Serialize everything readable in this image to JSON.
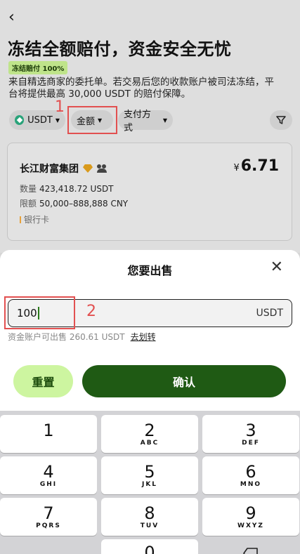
{
  "header": {
    "back_icon": "chevron-left-icon",
    "title": "冻结全额赔付，资金安全无忧",
    "badge": "冻结赔付 100%",
    "intro_line1": "来自精选商家的委托单。若交易后您的收款账户被司法冻结，平",
    "intro_line2": "台将提供最高 30,000 USDT 的赔付保障。"
  },
  "filters": {
    "currency": "USDT",
    "amount": "金额",
    "payment": "支付方式",
    "filter_icon": "funnel-icon"
  },
  "annotations": {
    "step1": "1",
    "step2": "2"
  },
  "offer": {
    "merchant": "长江财富集团",
    "currency_symbol": "¥",
    "price": "6.71",
    "quantity_label": "数量",
    "quantity_value": "423,418.72 USDT",
    "limit_label": "限额",
    "limit_value": "50,000–888,888 CNY",
    "payment_method": "银行卡"
  },
  "sheet": {
    "title": "您要出售",
    "close_icon": "close-icon",
    "input_value": "100",
    "input_unit": "USDT",
    "balance_text": "资金账户可出售 260.61 USDT",
    "transfer_link": "去划转",
    "reset_label": "重置",
    "confirm_label": "确认"
  },
  "keypad": {
    "keys": [
      {
        "digit": "1",
        "letters": ""
      },
      {
        "digit": "2",
        "letters": "ABC"
      },
      {
        "digit": "3",
        "letters": "DEF"
      },
      {
        "digit": "4",
        "letters": "GHI"
      },
      {
        "digit": "5",
        "letters": "JKL"
      },
      {
        "digit": "6",
        "letters": "MNO"
      },
      {
        "digit": "7",
        "letters": "PQRS"
      },
      {
        "digit": "8",
        "letters": "TUV"
      },
      {
        "digit": "9",
        "letters": "WXYZ"
      },
      {
        "digit": "0",
        "letters": ""
      }
    ]
  },
  "colors": {
    "accent_dark_green": "#1f5a14",
    "accent_light_green": "#cdf5a0",
    "annotation_red": "#e25050"
  }
}
